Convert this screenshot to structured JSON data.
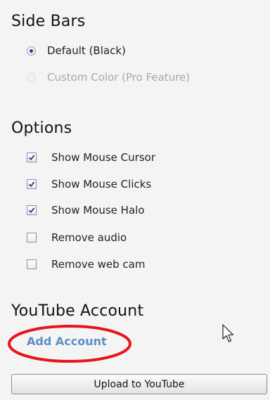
{
  "side_bars": {
    "title": "Side Bars",
    "options": [
      {
        "label": "Default (Black)",
        "checked": true,
        "enabled": true
      },
      {
        "label": "Custom Color (Pro Feature)",
        "checked": false,
        "enabled": false
      }
    ]
  },
  "options": {
    "title": "Options",
    "items": [
      {
        "label": "Show Mouse Cursor",
        "checked": true
      },
      {
        "label": "Show Mouse Clicks",
        "checked": true
      },
      {
        "label": "Show Mouse Halo",
        "checked": true
      },
      {
        "label": "Remove audio",
        "checked": false
      },
      {
        "label": "Remove web cam",
        "checked": false
      }
    ]
  },
  "youtube": {
    "title": "YouTube Account",
    "add_account_label": "Add Account",
    "upload_label": "Upload to YouTube"
  },
  "colors": {
    "link": "#5c8fc4",
    "annotation": "#e8141c",
    "radio_dot": "#1f3d8a",
    "checkmark": "#1f3d8a"
  },
  "icons": {
    "cursor": "mouse-pointer-icon",
    "checkmark": "checkmark-icon"
  }
}
